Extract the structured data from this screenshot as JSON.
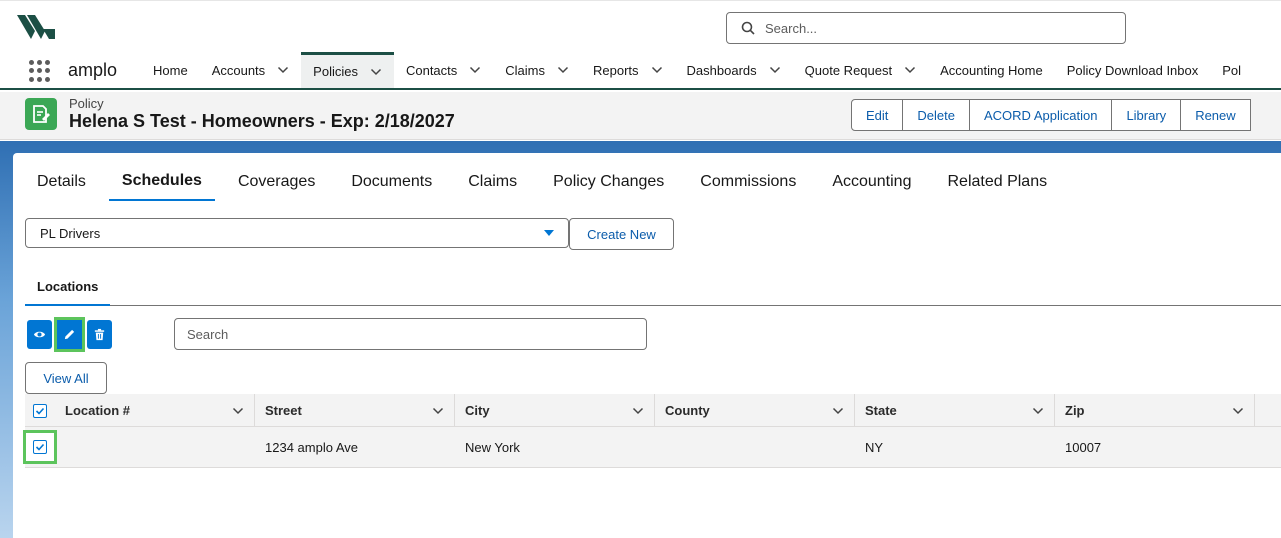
{
  "header": {
    "search_placeholder": "Search...",
    "app_name": "amplo"
  },
  "nav": {
    "items": [
      {
        "label": "Home",
        "dropdown": false,
        "active": false
      },
      {
        "label": "Accounts",
        "dropdown": true,
        "active": false
      },
      {
        "label": "Policies",
        "dropdown": true,
        "active": true
      },
      {
        "label": "Contacts",
        "dropdown": true,
        "active": false
      },
      {
        "label": "Claims",
        "dropdown": true,
        "active": false
      },
      {
        "label": "Reports",
        "dropdown": true,
        "active": false
      },
      {
        "label": "Dashboards",
        "dropdown": true,
        "active": false
      },
      {
        "label": "Quote Request",
        "dropdown": true,
        "active": false
      },
      {
        "label": "Accounting Home",
        "dropdown": false,
        "active": false
      },
      {
        "label": "Policy Download Inbox",
        "dropdown": false,
        "active": false
      },
      {
        "label": "Pol",
        "dropdown": false,
        "active": false
      }
    ]
  },
  "record": {
    "type": "Policy",
    "title": "Helena S Test - Homeowners - Exp: 2/18/2027",
    "actions": [
      "Edit",
      "Delete",
      "ACORD Application",
      "Library",
      "Renew"
    ]
  },
  "tabs": [
    "Details",
    "Schedules",
    "Coverages",
    "Documents",
    "Claims",
    "Policy Changes",
    "Commissions",
    "Accounting",
    "Related Plans"
  ],
  "active_tab": "Schedules",
  "schedule": {
    "selected": "PL Drivers",
    "create_label": "Create New"
  },
  "subtab": "Locations",
  "table_search_placeholder": "Search",
  "view_all_label": "View All",
  "table": {
    "columns": [
      "Location #",
      "Street",
      "City",
      "County",
      "State",
      "Zip"
    ],
    "rows": [
      {
        "checked": true,
        "location": "",
        "street": "1234 amplo Ave",
        "city": "New York",
        "county": "",
        "state": "NY",
        "zip": "10007"
      }
    ]
  },
  "colors": {
    "brand": "#1c4f45",
    "accent": "#0176d3",
    "record_icon": "#3ba755",
    "highlight": "#5cc45c"
  }
}
